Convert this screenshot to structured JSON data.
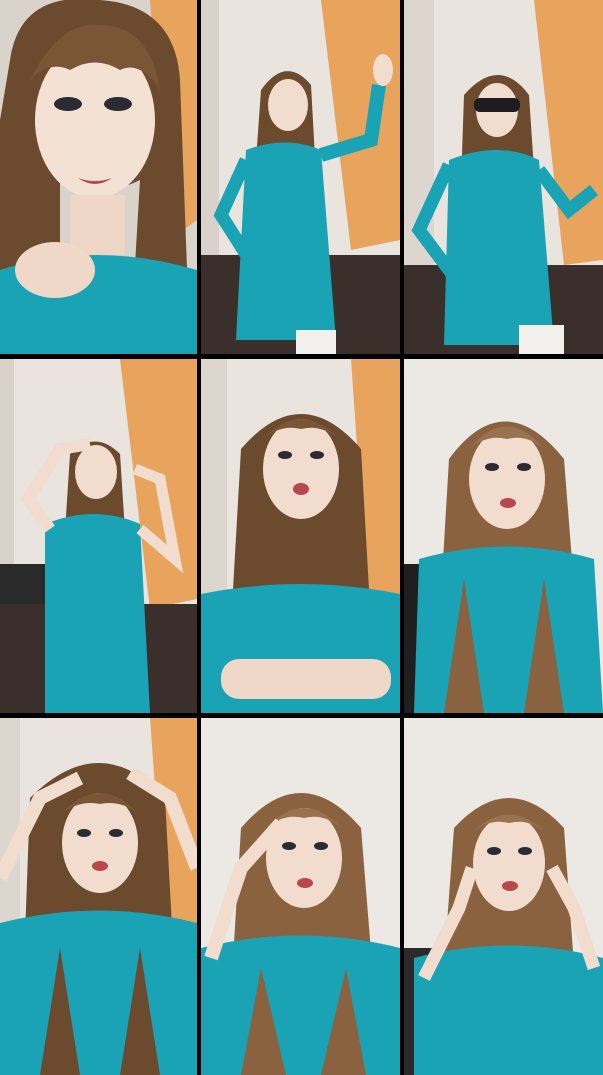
{
  "collage": {
    "rows": 3,
    "columns": 3,
    "background": "#000000",
    "palette": {
      "dress": "#1aa3b4",
      "dress_shadow": "#0d7f8f",
      "hair": "#6b4a2e",
      "hair_light": "#9a7250",
      "skin": "#f1dccd",
      "wall": "#e9e4dd",
      "orange_wall": "#e8a35c",
      "floor": "#3a2f2a"
    },
    "tiles": [
      {
        "id": "r1c1",
        "pose": "close-up-hand-on-chest",
        "framing": "face-close"
      },
      {
        "id": "r1c2",
        "pose": "arm-raised-hand-on-hip",
        "framing": "full-body"
      },
      {
        "id": "r1c3",
        "pose": "sunglasses-hand-on-hip",
        "framing": "full-body"
      },
      {
        "id": "r2c1",
        "pose": "hands-in-hair",
        "framing": "full-body"
      },
      {
        "id": "r2c2",
        "pose": "arms-crossed",
        "framing": "half-body"
      },
      {
        "id": "r2c3",
        "pose": "standing",
        "framing": "half-body"
      },
      {
        "id": "r3c1",
        "pose": "hands-on-head",
        "framing": "half-body"
      },
      {
        "id": "r3c2",
        "pose": "touching-hair",
        "framing": "half-body"
      },
      {
        "id": "r3c3",
        "pose": "hands-at-ears",
        "framing": "half-body"
      }
    ]
  }
}
